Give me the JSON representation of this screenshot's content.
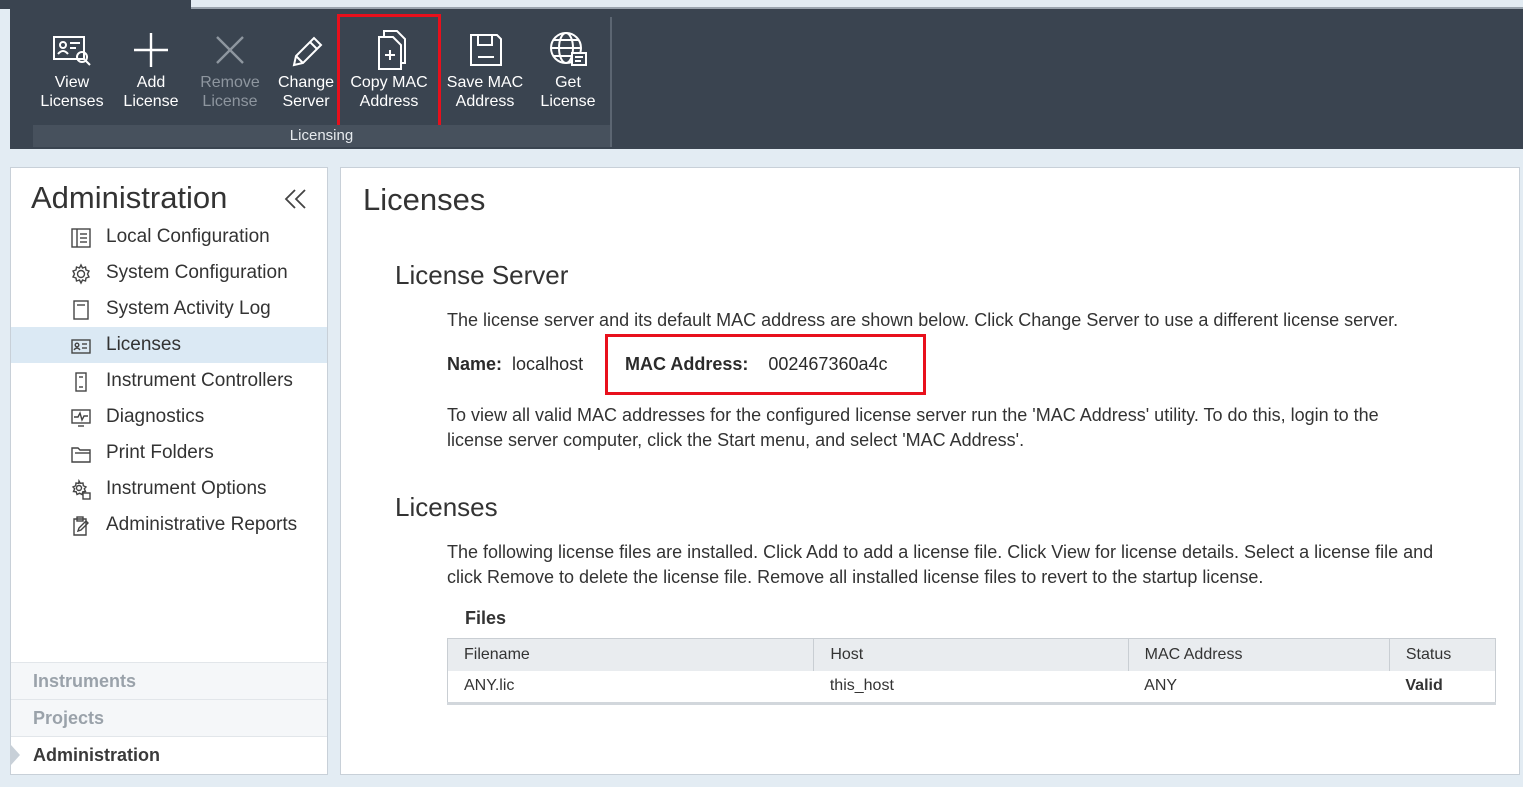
{
  "ribbon": {
    "buttons": [
      {
        "line1": "View",
        "line2": "Licenses",
        "icon": "view-licenses-icon",
        "enabled": true
      },
      {
        "line1": "Add",
        "line2": "License",
        "icon": "plus-icon",
        "enabled": true
      },
      {
        "line1": "Remove",
        "line2": "License",
        "icon": "x-icon",
        "enabled": false
      },
      {
        "line1": "Change",
        "line2": "Server",
        "icon": "pencil-icon",
        "enabled": true
      },
      {
        "line1": "Copy MAC",
        "line2": "Address",
        "icon": "copy-document-icon",
        "enabled": true,
        "highlighted": true
      },
      {
        "line1": "Save MAC",
        "line2": "Address",
        "icon": "save-icon",
        "enabled": true
      },
      {
        "line1": "Get",
        "line2": "License",
        "icon": "globe-icon",
        "enabled": true
      }
    ],
    "group_label": "Licensing"
  },
  "sidebar": {
    "title": "Administration",
    "items": [
      {
        "label": "Local Configuration",
        "icon": "local-config-icon"
      },
      {
        "label": "System Configuration",
        "icon": "gear-icon"
      },
      {
        "label": "System Activity Log",
        "icon": "log-icon"
      },
      {
        "label": "Licenses",
        "icon": "license-card-icon",
        "active": true
      },
      {
        "label": "Instrument Controllers",
        "icon": "controller-icon"
      },
      {
        "label": "Diagnostics",
        "icon": "diagnostics-icon"
      },
      {
        "label": "Print Folders",
        "icon": "folder-icon"
      },
      {
        "label": "Instrument Options",
        "icon": "gears-icon"
      },
      {
        "label": "Administrative Reports",
        "icon": "report-icon"
      }
    ],
    "bottom_nav": [
      "Instruments",
      "Projects",
      "Administration"
    ]
  },
  "main": {
    "title": "Licenses",
    "server_section": {
      "heading": "License Server",
      "intro": "The license server and its default MAC address are shown below. Click Change Server to use a different license server.",
      "name_label": "Name:",
      "name_value": "localhost",
      "mac_label": "MAC Address:",
      "mac_value": "002467360a4c",
      "note_line1": "To view all valid MAC addresses for the configured license server run the 'MAC Address' utility.  To do this, login to the",
      "note_line2": "license server computer, click the Start menu, and select 'MAC Address'."
    },
    "licenses_section": {
      "heading": "Licenses",
      "line1": "The following license files are installed. Click Add to add a license file. Click View for license details. Select a license file and",
      "line2": "click Remove to delete the license file. Remove all installed license files to revert to the startup license.",
      "files_label": "Files",
      "columns": [
        "Filename",
        "Host",
        "MAC Address",
        "Status"
      ],
      "rows": [
        [
          "ANY.lic",
          "this_host",
          "ANY",
          "Valid"
        ]
      ]
    }
  },
  "colors": {
    "ribbon_bg": "#3a4450",
    "highlight": "#e8101c",
    "active_nav": "#dbe9f4"
  }
}
